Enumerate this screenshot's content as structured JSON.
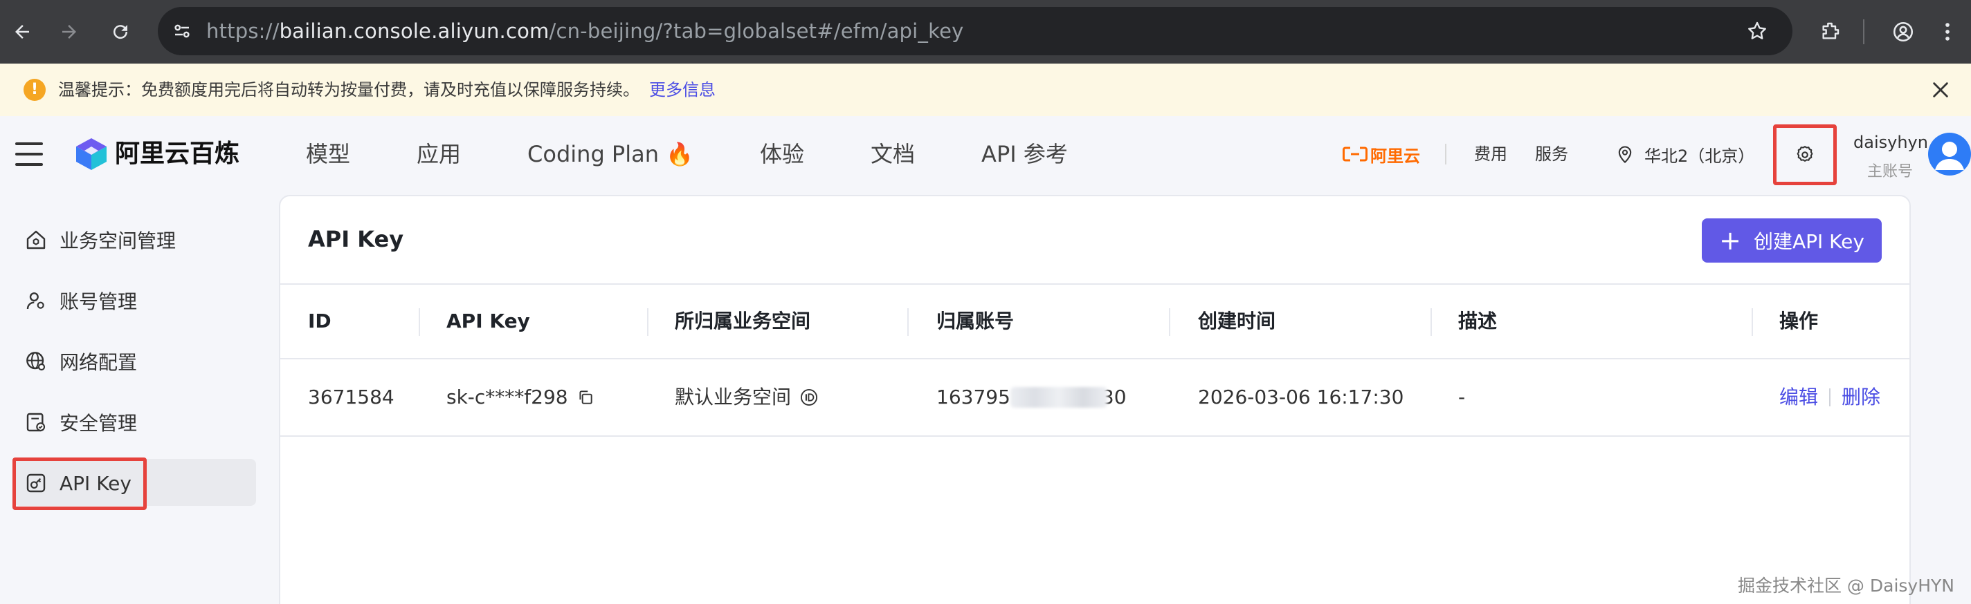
{
  "browser": {
    "url_prefix": "https://",
    "url_host": "bailian.console.aliyun.com",
    "url_path": "/cn-beijing/?tab=globalset#/efm/api_key"
  },
  "notice": {
    "text": "温馨提示：免费额度用完后将自动转为按量付费，请及时充值以保障服务持续。",
    "link": "更多信息"
  },
  "topnav": {
    "brand": "阿里云百炼",
    "tabs": [
      "模型",
      "应用",
      "Coding Plan 🔥",
      "体验",
      "文档",
      "API 参考"
    ],
    "aliyun_logo": "阿里云",
    "billing": "费用",
    "service": "服务",
    "region": "华北2（北京）",
    "user_name": "daisyhyn",
    "user_role": "主账号"
  },
  "sidebar": {
    "items": [
      {
        "label": "业务空间管理",
        "icon": "home-icon"
      },
      {
        "label": "账号管理",
        "icon": "user-icon"
      },
      {
        "label": "网络配置",
        "icon": "globe-icon"
      },
      {
        "label": "安全管理",
        "icon": "security-icon"
      },
      {
        "label": "API Key",
        "icon": "key-icon"
      }
    ]
  },
  "main": {
    "title": "API Key",
    "create_button": "创建API Key",
    "columns": [
      "ID",
      "API Key",
      "所归属业务空间",
      "归属账号",
      "创建时间",
      "描述",
      "操作"
    ],
    "rows": [
      {
        "id": "3671584",
        "api_key": "sk-c****f298",
        "workspace": "默认业务空间",
        "account_prefix": "163795",
        "account_suffix": "30",
        "created": "2026-03-06 16:17:30",
        "description": "-",
        "edit": "编辑",
        "delete": "删除"
      }
    ]
  },
  "watermark": "掘金技术社区 @ DaisyHYN",
  "colors": {
    "accent": "#6159e6",
    "link": "#4b4de4",
    "highlight": "#e6423c",
    "aliyun_orange": "#ff6a00"
  }
}
